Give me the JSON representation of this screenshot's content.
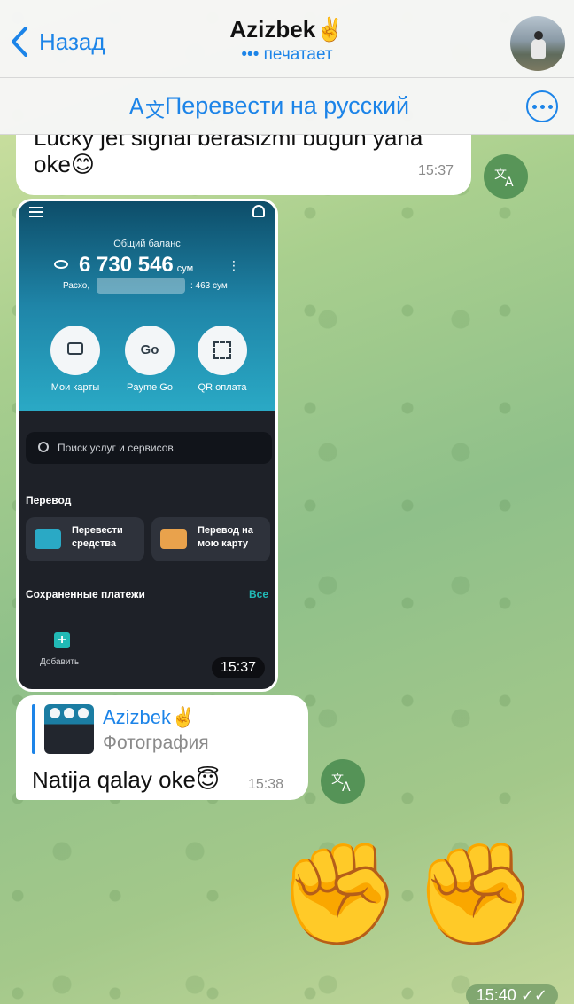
{
  "header": {
    "back_label": "Назад",
    "title": "Azizbek✌️",
    "status": "••• печатает"
  },
  "translate_bar": {
    "label": "Перевести на русский"
  },
  "messages": [
    {
      "text_line1": "Lucky jet signal berasizmi bugun yana",
      "text_line2": "oke😊",
      "time": "15:37"
    },
    {
      "type": "photo",
      "time": "15:37",
      "screenshot": {
        "total_label": "Общий баланс",
        "balance": "6 730 546",
        "currency": "сум",
        "expense_label": "Расхо,",
        "expense_value": ": 463 сум",
        "actions": [
          "Мои карты",
          "Payme Go",
          "QR оплата"
        ],
        "search_placeholder": "Поиск услуг и сервисов",
        "transfer_title": "Перевод",
        "transfer_cards": [
          "Перевести средства",
          "Перевод на мою карту"
        ],
        "saved_title": "Сохраненные платежи",
        "all_link": "Все",
        "add_label": "Добавить"
      }
    },
    {
      "reply_name": "Azizbek✌️",
      "reply_type": "Фотография",
      "text": "Natija qalay oke😇",
      "time": "15:38"
    },
    {
      "outgoing": true,
      "emoji": "✊✊",
      "time": "15:40"
    }
  ],
  "colors": {
    "accent": "#1c84e8",
    "bubble": "#ffffff",
    "translate_button": "#3c8246"
  }
}
